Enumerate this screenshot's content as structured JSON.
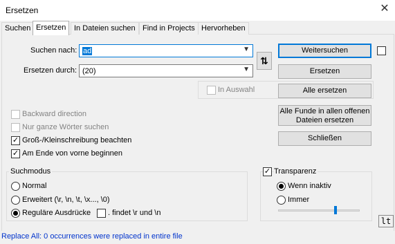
{
  "window": {
    "title": "Ersetzen",
    "close_glyph": "✕"
  },
  "tabs": [
    "Suchen",
    "Ersetzen",
    "In Dateien suchen",
    "Find in Projects",
    "Hervorheben"
  ],
  "find": {
    "label": "Suchen nach:",
    "value": "ad"
  },
  "replace": {
    "label": "Ersetzen durch:",
    "value": "(20)"
  },
  "swap_icon": "⇅",
  "buttons": {
    "find_next": "Weitersuchen",
    "replace": "Ersetzen",
    "replace_all": "Alle ersetzen",
    "replace_all_open_line1": "Alle Funde in allen offenen",
    "replace_all_open_line2": "Dateien ersetzen",
    "close": "Schließen"
  },
  "in_selection": "In Auswahl",
  "options": {
    "backward": "Backward direction",
    "whole_words": "Nur ganze Wörter suchen",
    "match_case": "Groß-/Kleinschreibung beachten",
    "wrap_around": "Am Ende von vorne beginnen"
  },
  "search_mode": {
    "title": "Suchmodus",
    "normal": "Normal",
    "extended": "Erweitert (\\r, \\n, \\t, \\x..., \\0)",
    "regex": "Reguläre Ausdrücke",
    "dot_matches": ". findet \\r und \\n"
  },
  "transparency": {
    "title": "Transparenz",
    "on_lose_focus": "Wenn inaktiv",
    "always": "Immer"
  },
  "lt_label": "lt",
  "status": "Replace All: 0 occurrences were replaced in entire file"
}
